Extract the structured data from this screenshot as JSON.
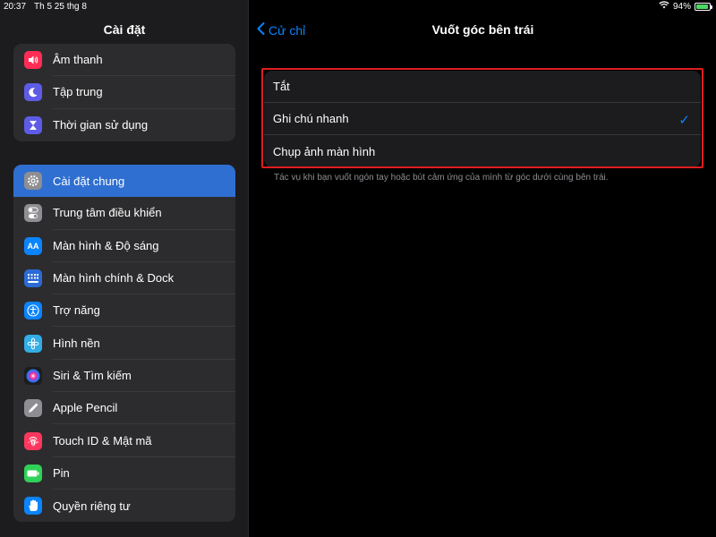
{
  "status_bar": {
    "time": "20:37",
    "date": "Th 5 25 thg 8",
    "battery": "94%",
    "battery_level": 0.94
  },
  "sidebar": {
    "title": "Cài đặt",
    "group1": [
      {
        "label": "Âm thanh",
        "icon": "speaker-icon",
        "color": "#ff2d55"
      },
      {
        "label": "Tập trung",
        "icon": "moon-icon",
        "color": "#5e5ce6"
      },
      {
        "label": "Thời gian sử dụng",
        "icon": "hourglass-icon",
        "color": "#5e5ce6"
      }
    ],
    "group2": [
      {
        "label": "Cài đặt chung",
        "icon": "gear-icon",
        "color": "#8e8e93",
        "active": true
      },
      {
        "label": "Trung tâm điều khiển",
        "icon": "toggles-icon",
        "color": "#8e8e93"
      },
      {
        "label": "Màn hình & Độ sáng",
        "icon": "text-size-icon",
        "color": "#0a84ff"
      },
      {
        "label": "Màn hình chính & Dock",
        "icon": "home-grid-icon",
        "color": "#2c6bd6"
      },
      {
        "label": "Trợ năng",
        "icon": "accessibility-icon",
        "color": "#0a84ff"
      },
      {
        "label": "Hình nền",
        "icon": "wallpaper-flower-icon",
        "color": "#32ade6"
      },
      {
        "label": "Siri & Tìm kiếm",
        "icon": "siri-icon",
        "color": "#1c1c1e"
      },
      {
        "label": "Apple Pencil",
        "icon": "pencil-icon",
        "color": "#8e8e93"
      },
      {
        "label": "Touch ID & Mật mã",
        "icon": "fingerprint-icon",
        "color": "#ff375f"
      },
      {
        "label": "Pin",
        "icon": "battery-icon",
        "color": "#30d158"
      },
      {
        "label": "Quyền riêng tư",
        "icon": "hand-icon",
        "color": "#0a84ff"
      }
    ]
  },
  "main": {
    "back_label": "Cử chỉ",
    "title": "Vuốt góc bên trái",
    "options": [
      {
        "label": "Tắt",
        "selected": false
      },
      {
        "label": "Ghi chú nhanh",
        "selected": true
      },
      {
        "label": "Chụp ảnh màn hình",
        "selected": false
      }
    ],
    "check_glyph": "✓",
    "footer": "Tác vụ khi bạn vuốt ngón tay hoặc bút cảm ứng của mình từ góc dưới cùng bên trái."
  },
  "colors": {
    "accent": "#0a84ff",
    "highlight_border": "#e01e1e"
  }
}
